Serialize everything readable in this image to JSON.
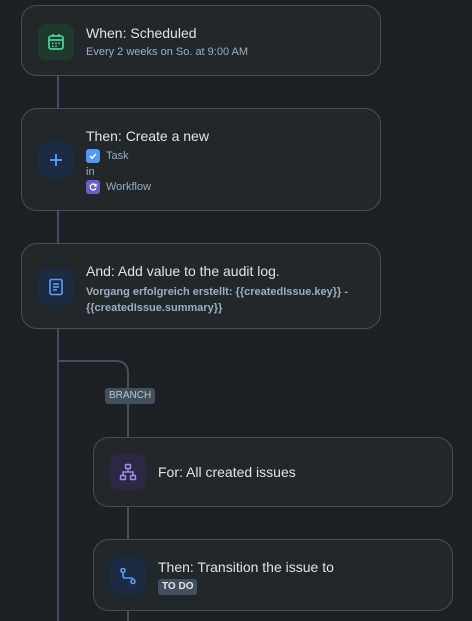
{
  "trigger": {
    "title": "When: Scheduled",
    "subtitle": "Every 2 weeks on So. at 9:00 AM",
    "icon": "calendar-icon",
    "color": "#4bce97"
  },
  "create_action": {
    "title": "Then: Create a new",
    "issue_type": "Task",
    "in_label": "in",
    "project": "Workflow",
    "icon": "plus-icon",
    "color": "#579dff"
  },
  "audit_action": {
    "title": "And: Add value to the audit log.",
    "detail": "Vorgang erfolgreich erstellt: {{createdIssue.key}} - {{createdIssue.summary}}",
    "icon": "document-icon",
    "color": "#579dff"
  },
  "branch": {
    "tag": "BRANCH",
    "for_title": "For: All created issues",
    "for_icon": "hierarchy-icon",
    "for_color": "#9f8fef"
  },
  "transition_action": {
    "title": "Then: Transition the issue to",
    "status": "TO DO",
    "icon": "transition-icon",
    "color": "#579dff"
  }
}
